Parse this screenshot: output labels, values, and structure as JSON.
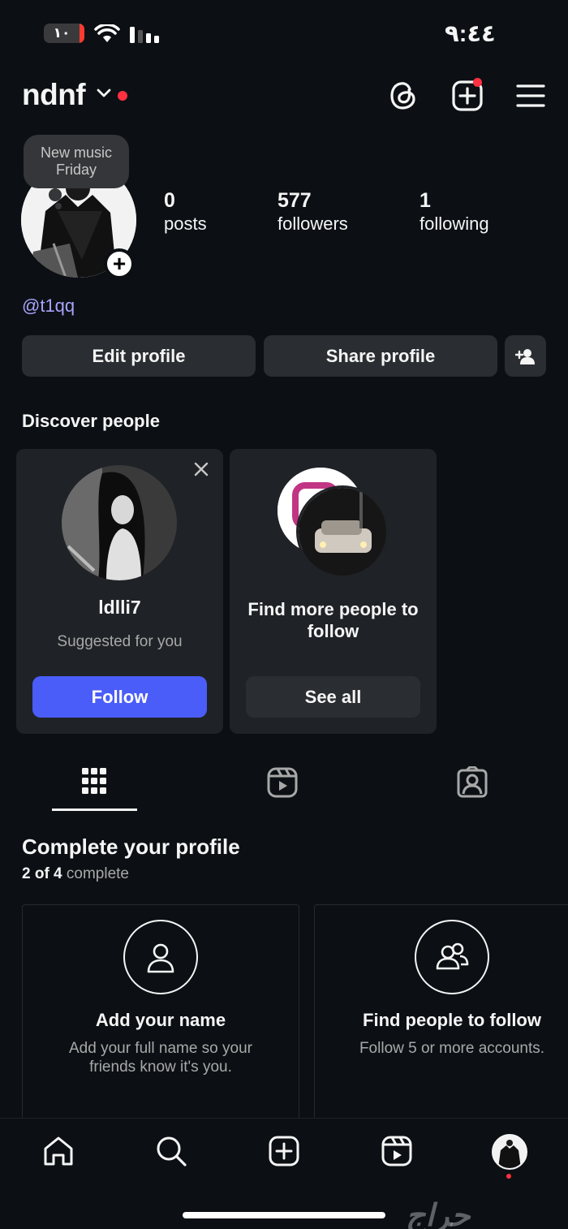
{
  "status_bar": {
    "time": "٩:٤٤",
    "battery": "١٠"
  },
  "header": {
    "username": "ndnf"
  },
  "profile": {
    "note": "New music Friday",
    "stats": [
      {
        "value": "0",
        "label": "posts"
      },
      {
        "value": "577",
        "label": "followers"
      },
      {
        "value": "1",
        "label": "following"
      }
    ],
    "handle": "@t1qq",
    "edit_label": "Edit profile",
    "share_label": "Share profile"
  },
  "discover": {
    "title": "Discover people",
    "suggestion": {
      "name": "ldlli7",
      "subtitle": "Suggested for you",
      "button": "Follow"
    },
    "find_more": {
      "text": "Find more people to follow",
      "button": "See all"
    }
  },
  "tabs": [
    "grid-icon",
    "reels-icon",
    "tagged-icon"
  ],
  "complete_profile": {
    "title": "Complete your profile",
    "progress_done": "2 of 4",
    "progress_word": "complete",
    "cards": [
      {
        "icon": "person-icon",
        "title": "Add your name",
        "desc": "Add your full name so your friends know it's you."
      },
      {
        "icon": "people-icon",
        "title": "Find people to follow",
        "desc": "Follow 5 or more accounts."
      }
    ]
  },
  "bottom_nav": [
    "home-icon",
    "search-icon",
    "create-icon",
    "reels-icon",
    "profile-avatar"
  ],
  "watermark": "حراج",
  "colors": {
    "background": "#0c1014",
    "accent": "#4a5df9",
    "notification": "#ff3040",
    "link": "#a8a4ff"
  }
}
